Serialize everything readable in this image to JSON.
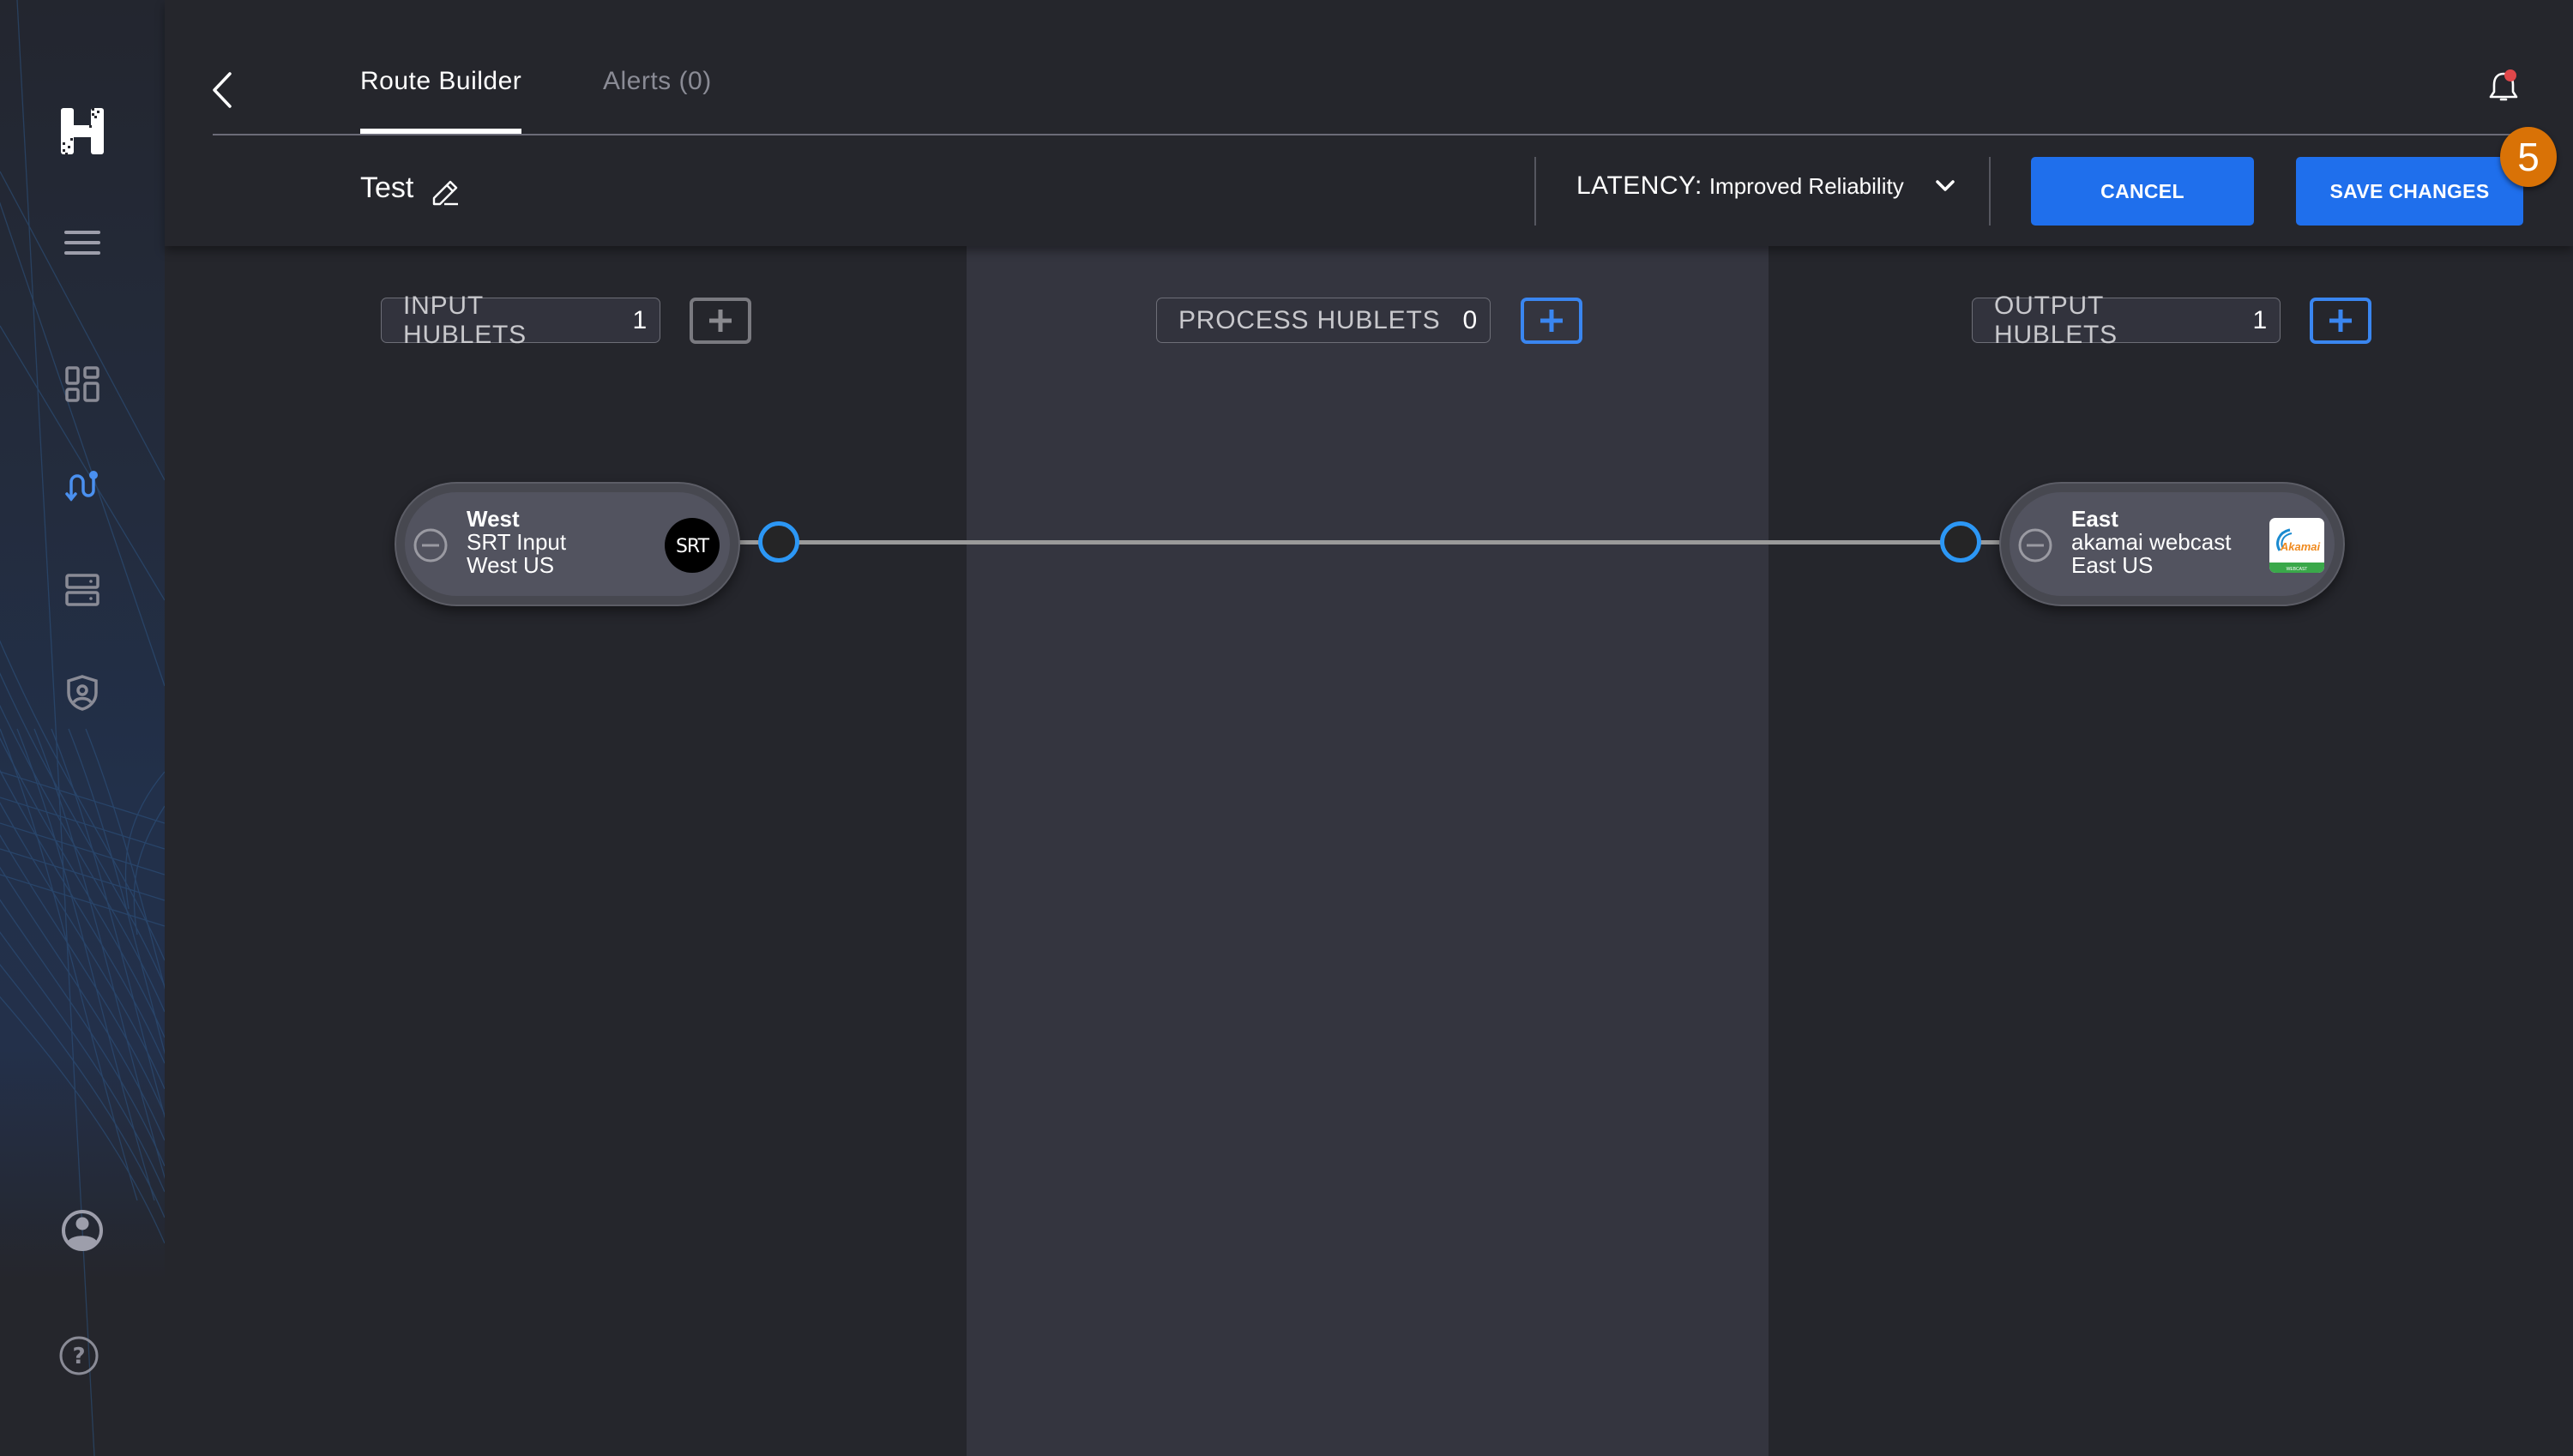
{
  "sidebar": {
    "logo": "hubl-logo",
    "items": [
      {
        "icon": "menu-icon",
        "active": false
      },
      {
        "icon": "dashboard-icon",
        "active": false
      },
      {
        "icon": "route-icon",
        "active": true
      },
      {
        "icon": "server-icon",
        "active": false
      },
      {
        "icon": "security-shield-icon",
        "active": false
      },
      {
        "icon": "user-account-icon",
        "active": false
      },
      {
        "icon": "help-icon",
        "active": false
      }
    ]
  },
  "header": {
    "tabs": [
      {
        "label": "Route Builder",
        "active": true
      },
      {
        "label": "Alerts (0)",
        "active": false
      }
    ],
    "route_name": "Test",
    "latency": {
      "label": "LATENCY:",
      "value": "Improved Reliability"
    },
    "cancel_label": "CANCEL",
    "save_label": "SAVE CHANGES",
    "step_badge": "5",
    "notification_dot": true
  },
  "columns": [
    {
      "label": "INPUT HUBLETS",
      "count": "1",
      "add_enabled": false
    },
    {
      "label": "PROCESS HUBLETS",
      "count": "0",
      "add_enabled": true
    },
    {
      "label": "OUTPUT HUBLETS",
      "count": "1",
      "add_enabled": true
    }
  ],
  "nodes": {
    "input": {
      "title": "West",
      "type": "SRT Input",
      "region": "West US",
      "logo_text": "SRT"
    },
    "output": {
      "title": "East",
      "type": "akamai webcast",
      "region": "East US",
      "logo_text": "Akamai",
      "logo_subtext": "WEBCAST"
    }
  },
  "colors": {
    "accent": "#1f6fec",
    "connector": "#2c97f5",
    "badge": "#d97206",
    "notification_dot": "#e0474a"
  }
}
